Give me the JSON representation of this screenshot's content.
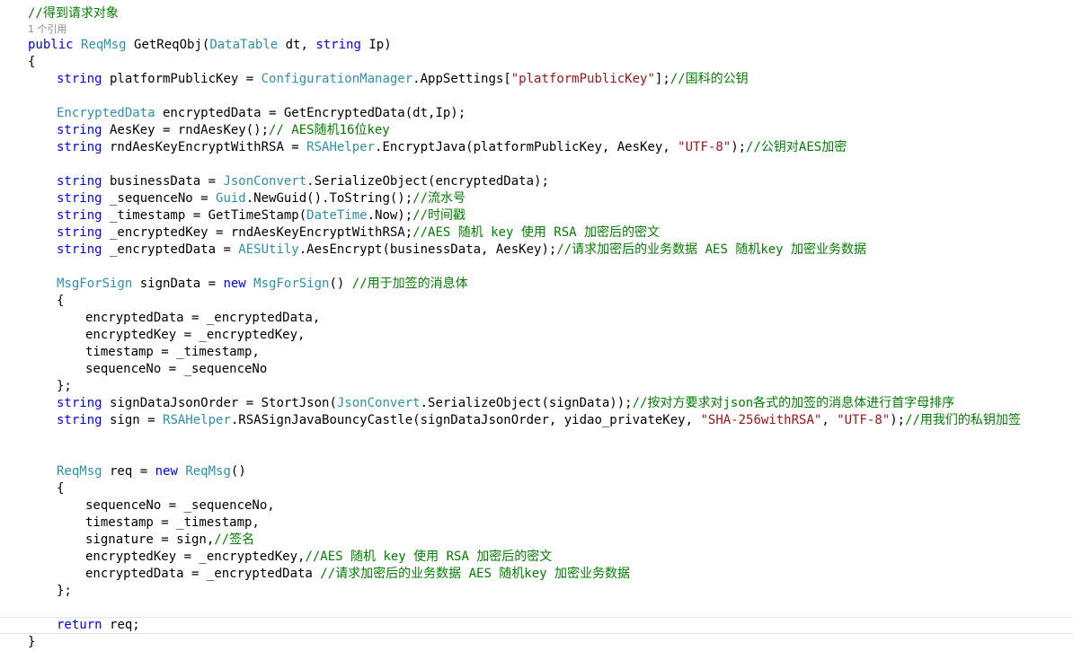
{
  "codelens": {
    "references": "1 个引用"
  },
  "code": [
    {
      "indent": 1,
      "tokens": [
        {
          "t": "//得到请求对象",
          "c": "c"
        }
      ]
    },
    {
      "lens": true
    },
    {
      "indent": 1,
      "tokens": [
        {
          "t": "public ",
          "c": "k"
        },
        {
          "t": "ReqMsg",
          "c": "t"
        },
        {
          "t": " GetReqObj(",
          "c": "p"
        },
        {
          "t": "DataTable",
          "c": "t"
        },
        {
          "t": " dt, ",
          "c": "p"
        },
        {
          "t": "string",
          "c": "k"
        },
        {
          "t": " Ip)",
          "c": "p"
        }
      ]
    },
    {
      "indent": 1,
      "tokens": [
        {
          "t": "{",
          "c": "p"
        }
      ]
    },
    {
      "indent": 2,
      "tokens": [
        {
          "t": "string",
          "c": "k"
        },
        {
          "t": " platformPublicKey = ",
          "c": "p"
        },
        {
          "t": "ConfigurationManager",
          "c": "t"
        },
        {
          "t": ".AppSettings[",
          "c": "p"
        },
        {
          "t": "\"platformPublicKey\"",
          "c": "s"
        },
        {
          "t": "];",
          "c": "p"
        },
        {
          "t": "//国科的公钥",
          "c": "c"
        }
      ]
    },
    {
      "indent": 0,
      "tokens": []
    },
    {
      "indent": 2,
      "tokens": [
        {
          "t": "EncryptedData",
          "c": "t"
        },
        {
          "t": " encryptedData = GetEncryptedData(dt,Ip);",
          "c": "p"
        }
      ]
    },
    {
      "indent": 2,
      "tokens": [
        {
          "t": "string",
          "c": "k"
        },
        {
          "t": " AesKey = rndAesKey();",
          "c": "p"
        },
        {
          "t": "// AES随机16位key",
          "c": "c"
        }
      ]
    },
    {
      "indent": 2,
      "tokens": [
        {
          "t": "string",
          "c": "k"
        },
        {
          "t": " rndAesKeyEncryptWithRSA = ",
          "c": "p"
        },
        {
          "t": "RSAHelper",
          "c": "t"
        },
        {
          "t": ".EncryptJava(platformPublicKey, AesKey, ",
          "c": "p"
        },
        {
          "t": "\"UTF-8\"",
          "c": "s"
        },
        {
          "t": ");",
          "c": "p"
        },
        {
          "t": "//公钥对AES加密",
          "c": "c"
        }
      ]
    },
    {
      "indent": 0,
      "tokens": []
    },
    {
      "indent": 2,
      "tokens": [
        {
          "t": "string",
          "c": "k"
        },
        {
          "t": " businessData = ",
          "c": "p"
        },
        {
          "t": "JsonConvert",
          "c": "t"
        },
        {
          "t": ".SerializeObject(encryptedData);",
          "c": "p"
        }
      ]
    },
    {
      "indent": 2,
      "tokens": [
        {
          "t": "string",
          "c": "k"
        },
        {
          "t": " _sequenceNo = ",
          "c": "p"
        },
        {
          "t": "Guid",
          "c": "t"
        },
        {
          "t": ".NewGuid().ToString();",
          "c": "p"
        },
        {
          "t": "//流水号",
          "c": "c"
        }
      ]
    },
    {
      "indent": 2,
      "tokens": [
        {
          "t": "string",
          "c": "k"
        },
        {
          "t": " _timestamp = GetTimeStamp(",
          "c": "p"
        },
        {
          "t": "DateTime",
          "c": "t"
        },
        {
          "t": ".Now);",
          "c": "p"
        },
        {
          "t": "//时间戳",
          "c": "c"
        }
      ]
    },
    {
      "indent": 2,
      "tokens": [
        {
          "t": "string",
          "c": "k"
        },
        {
          "t": " _encryptedKey = rndAesKeyEncryptWithRSA;",
          "c": "p"
        },
        {
          "t": "//AES 随机 key 使用 RSA 加密后的密文",
          "c": "c"
        }
      ]
    },
    {
      "indent": 2,
      "tokens": [
        {
          "t": "string",
          "c": "k"
        },
        {
          "t": " _encryptedData = ",
          "c": "p"
        },
        {
          "t": "AESUtily",
          "c": "t"
        },
        {
          "t": ".AesEncrypt(businessData, AesKey);",
          "c": "p"
        },
        {
          "t": "//请求加密后的业务数据 AES 随机key 加密业务数据",
          "c": "c"
        }
      ]
    },
    {
      "indent": 0,
      "tokens": []
    },
    {
      "indent": 2,
      "tokens": [
        {
          "t": "MsgForSign",
          "c": "t"
        },
        {
          "t": " signData = ",
          "c": "p"
        },
        {
          "t": "new ",
          "c": "k"
        },
        {
          "t": "MsgForSign",
          "c": "t"
        },
        {
          "t": "() ",
          "c": "p"
        },
        {
          "t": "//用于加签的消息体",
          "c": "c"
        }
      ]
    },
    {
      "indent": 2,
      "tokens": [
        {
          "t": "{",
          "c": "p"
        }
      ]
    },
    {
      "indent": 3,
      "tokens": [
        {
          "t": "encryptedData = _encryptedData,",
          "c": "p"
        }
      ]
    },
    {
      "indent": 3,
      "tokens": [
        {
          "t": "encryptedKey = _encryptedKey,",
          "c": "p"
        }
      ]
    },
    {
      "indent": 3,
      "tokens": [
        {
          "t": "timestamp = _timestamp,",
          "c": "p"
        }
      ]
    },
    {
      "indent": 3,
      "tokens": [
        {
          "t": "sequenceNo = _sequenceNo",
          "c": "p"
        }
      ]
    },
    {
      "indent": 2,
      "tokens": [
        {
          "t": "};",
          "c": "p"
        }
      ]
    },
    {
      "indent": 2,
      "tokens": [
        {
          "t": "string",
          "c": "k"
        },
        {
          "t": " signDataJsonOrder = StortJson(",
          "c": "p"
        },
        {
          "t": "JsonConvert",
          "c": "t"
        },
        {
          "t": ".SerializeObject(signData));",
          "c": "p"
        },
        {
          "t": "//按对方要求对json各式的加签的消息体进行首字母排序",
          "c": "c"
        }
      ]
    },
    {
      "indent": 2,
      "tokens": [
        {
          "t": "string",
          "c": "k"
        },
        {
          "t": " sign = ",
          "c": "p"
        },
        {
          "t": "RSAHelper",
          "c": "t"
        },
        {
          "t": ".RSASignJavaBouncyCastle(signDataJsonOrder, yidao_privateKey, ",
          "c": "p"
        },
        {
          "t": "\"SHA-256withRSA\"",
          "c": "s"
        },
        {
          "t": ", ",
          "c": "p"
        },
        {
          "t": "\"UTF-8\"",
          "c": "s"
        },
        {
          "t": ");",
          "c": "p"
        },
        {
          "t": "//用我们的私钥加签",
          "c": "c"
        }
      ]
    },
    {
      "indent": 0,
      "tokens": []
    },
    {
      "indent": 0,
      "tokens": []
    },
    {
      "indent": 2,
      "tokens": [
        {
          "t": "ReqMsg",
          "c": "t"
        },
        {
          "t": " req = ",
          "c": "p"
        },
        {
          "t": "new ",
          "c": "k"
        },
        {
          "t": "ReqMsg",
          "c": "t"
        },
        {
          "t": "()",
          "c": "p"
        }
      ]
    },
    {
      "indent": 2,
      "tokens": [
        {
          "t": "{",
          "c": "p"
        }
      ]
    },
    {
      "indent": 3,
      "tokens": [
        {
          "t": "sequenceNo = _sequenceNo,",
          "c": "p"
        }
      ]
    },
    {
      "indent": 3,
      "tokens": [
        {
          "t": "timestamp = _timestamp,",
          "c": "p"
        }
      ]
    },
    {
      "indent": 3,
      "tokens": [
        {
          "t": "signature = sign,",
          "c": "p"
        },
        {
          "t": "//签名",
          "c": "c"
        }
      ]
    },
    {
      "indent": 3,
      "tokens": [
        {
          "t": "encryptedKey = _encryptedKey,",
          "c": "p"
        },
        {
          "t": "//AES 随机 key 使用 RSA 加密后的密文",
          "c": "c"
        }
      ]
    },
    {
      "indent": 3,
      "tokens": [
        {
          "t": "encryptedData = _encryptedData ",
          "c": "p"
        },
        {
          "t": "//请求加密后的业务数据 AES 随机key 加密业务数据",
          "c": "c"
        }
      ]
    },
    {
      "indent": 2,
      "tokens": [
        {
          "t": "};",
          "c": "p"
        }
      ]
    },
    {
      "indent": 0,
      "tokens": []
    },
    {
      "indent": 2,
      "current": true,
      "tokens": [
        {
          "t": "return ",
          "c": "k"
        },
        {
          "t": "req;",
          "c": "p"
        }
      ]
    },
    {
      "indent": 1,
      "tokens": [
        {
          "t": "}",
          "c": "p"
        }
      ]
    }
  ]
}
